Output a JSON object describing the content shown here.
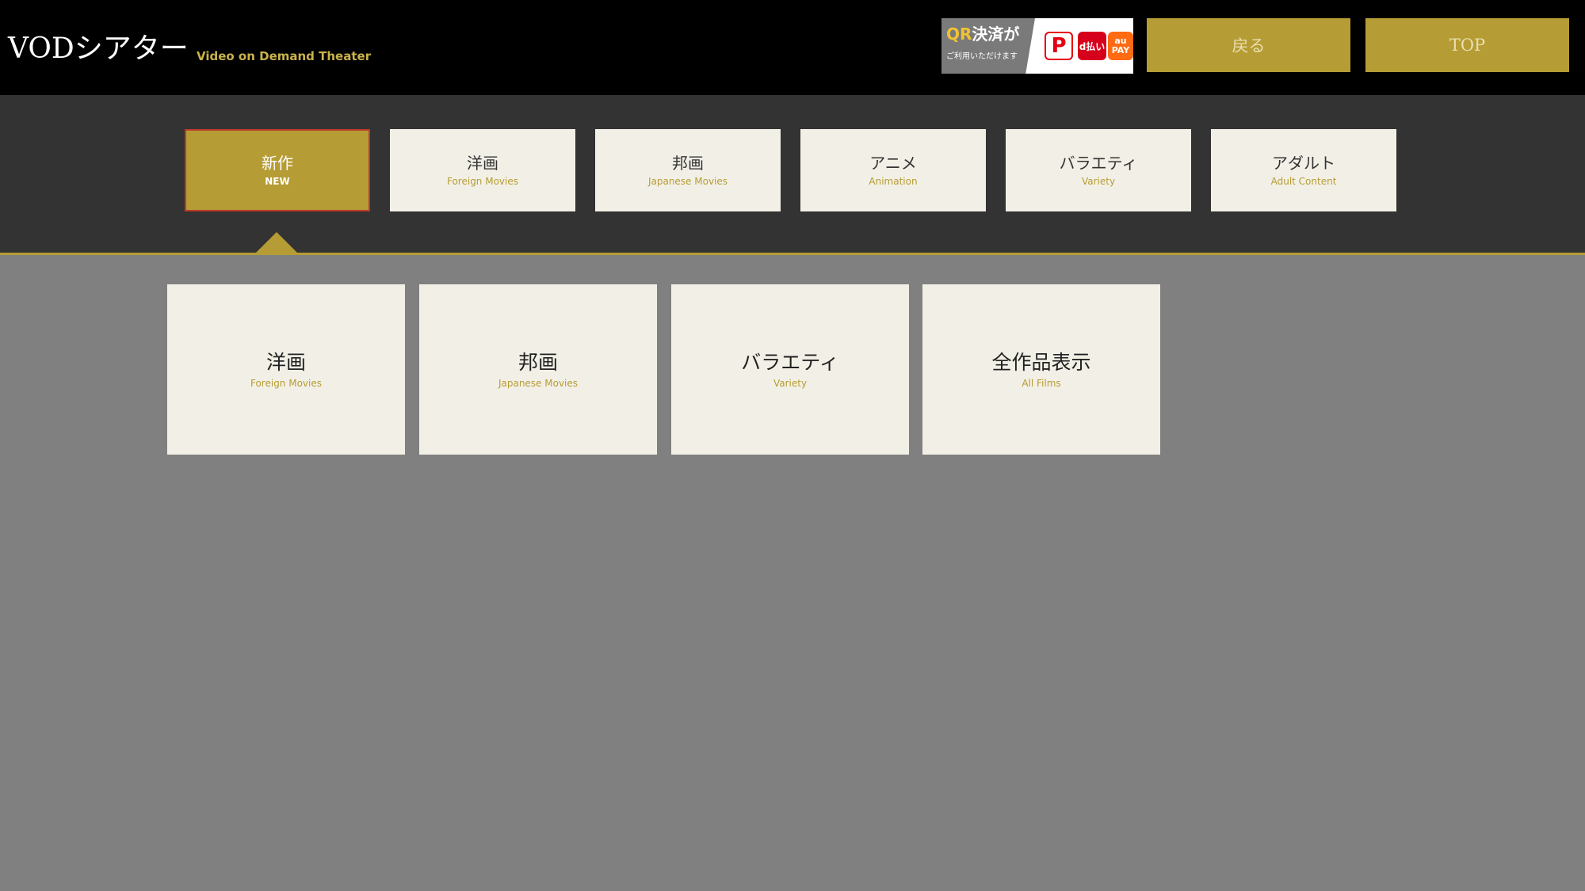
{
  "header": {
    "logo": "VODシアター",
    "subtitle": "Video on Demand Theater",
    "qr_banner": {
      "mark": "QR",
      "line1_rest": "決済が",
      "line2": "ご利用いただけます",
      "paypay": "P",
      "dpay": "d払い",
      "aupay_top": "au",
      "aupay_bottom": "PAY"
    },
    "back_label": "戻る",
    "top_label": "TOP"
  },
  "categories": [
    {
      "jp": "新作",
      "en": "NEW",
      "active": true
    },
    {
      "jp": "洋画",
      "en": "Foreign Movies"
    },
    {
      "jp": "邦画",
      "en": "Japanese Movies"
    },
    {
      "jp": "アニメ",
      "en": "Animation"
    },
    {
      "jp": "バラエティ",
      "en": "Variety"
    },
    {
      "jp": "アダルト",
      "en": "Adult Content"
    }
  ],
  "subcategories": [
    {
      "jp": "洋画",
      "en": "Foreign Movies"
    },
    {
      "jp": "邦画",
      "en": "Japanese Movies"
    },
    {
      "jp": "バラエティ",
      "en": "Variety"
    },
    {
      "jp": "全作品表示",
      "en": "All Films"
    }
  ],
  "colors": {
    "header_bg": "#000000",
    "accent_gold": "#b69c34",
    "card_bg": "#f2f0e6",
    "cat_bar_bg": "#333333",
    "content_bg": "#808080",
    "active_border": "#c0392b"
  }
}
